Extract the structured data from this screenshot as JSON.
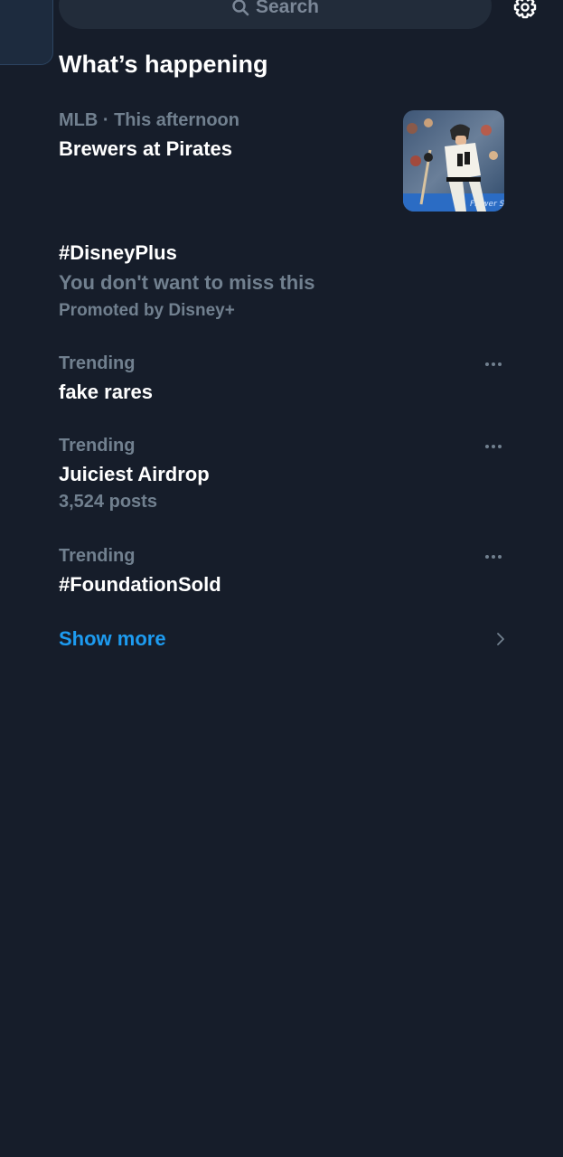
{
  "search": {
    "label": "Search"
  },
  "section": {
    "title": "What’s happening"
  },
  "trends": [
    {
      "meta": "MLB · This afternoon",
      "headline": "Brewers at Pirates",
      "has_image": true,
      "image_icon": "baseball-player-image"
    },
    {
      "headline": "#DisneyPlus",
      "description": "You don't want to miss this",
      "promoted": "Promoted by Disney+"
    },
    {
      "meta": "Trending",
      "headline": "fake rares"
    },
    {
      "meta": "Trending",
      "headline": "Juiciest Airdrop",
      "count": "3,524 posts"
    },
    {
      "meta": "Trending",
      "headline": "#FoundationSold"
    }
  ],
  "show_more": {
    "label": "Show more"
  },
  "colors": {
    "background": "#161d2a",
    "accent": "#1d9bf0",
    "secondary_text": "#71808f",
    "primary_text": "#ffffff"
  }
}
